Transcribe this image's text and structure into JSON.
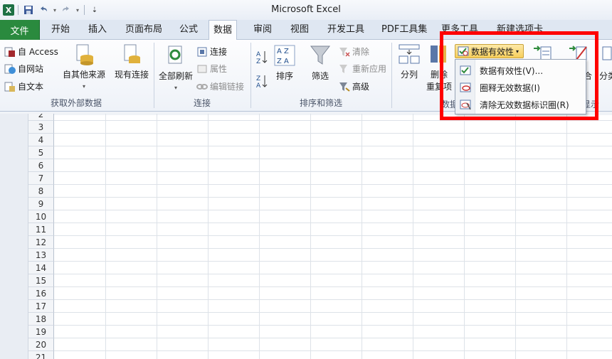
{
  "window": {
    "title": "Microsoft Excel",
    "app_logo": "X"
  },
  "qat": {
    "save_icon": "save-icon",
    "undo_icon": "undo-icon",
    "redo_icon": "redo-icon",
    "customize_icon": "customize-icon"
  },
  "tabs": {
    "file": "文件",
    "items": [
      "开始",
      "插入",
      "页面布局",
      "公式",
      "数据",
      "审阅",
      "视图",
      "开发工具",
      "PDF工具集",
      "更多工具",
      "新建选项卡"
    ],
    "active": "数据"
  },
  "ribbon": {
    "get_external": {
      "access": "自 Access",
      "web": "自网站",
      "text": "自文本",
      "other_sources": "自其他来源",
      "existing": "现有连接",
      "label": "获取外部数据"
    },
    "connections": {
      "refresh_all": "全部刷新",
      "connections": "连接",
      "properties": "属性",
      "edit_links": "编辑链接",
      "label": "连接"
    },
    "sort_filter": {
      "sort": "排序",
      "filter": "筛选",
      "clear": "清除",
      "reapply": "重新应用",
      "advanced": "高级",
      "label": "排序和筛选"
    },
    "data_tools": {
      "text_to_columns": "分列",
      "remove_dup_1": "删除",
      "remove_dup_2": "重复项",
      "data_validation": "数据有效性",
      "label_partial": "数据",
      "merge_partial": "合",
      "subtotal_partial": "分类",
      "outline_partial": "显示"
    }
  },
  "dropdown": {
    "items": [
      {
        "label": "数据有效性(V)...",
        "icon": "data-validation-icon"
      },
      {
        "label": "圈释无效数据(I)",
        "icon": "circle-invalid-icon"
      },
      {
        "label": "清除无效数据标识圈(R)",
        "icon": "clear-circles-icon"
      }
    ]
  },
  "grid": {
    "row_numbers": [
      "2",
      "3",
      "4",
      "5",
      "6",
      "7",
      "8",
      "9",
      "10",
      "11",
      "12",
      "13",
      "14",
      "15",
      "16",
      "17",
      "18",
      "19",
      "20",
      "21"
    ]
  },
  "colors": {
    "file_tab": "#2a8a3e",
    "highlight": "#ff0000",
    "dv_button": "#f7cf5c"
  }
}
